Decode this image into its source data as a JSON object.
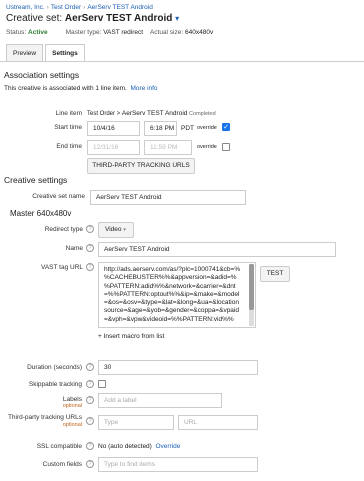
{
  "breadcrumb": {
    "items": [
      "Ustream, Inc.",
      "Test Order",
      "AerServ TEST Android"
    ],
    "separator": "›"
  },
  "header": {
    "title_prefix": "Creative set:",
    "title_name": "AerServ TEST Android",
    "status_label": "Status:",
    "status_value": "Active",
    "master_type_label": "Master type:",
    "master_type_value": "VAST redirect",
    "actual_size_label": "Actual size:",
    "actual_size_value": "640x480v"
  },
  "tabs": [
    "Preview",
    "Settings"
  ],
  "association": {
    "heading": "Association settings",
    "info_text": "This creative is associated with 1 line item.",
    "more_info": "More info",
    "line_item_label": "Line item",
    "line_item_order": "Test Order",
    "line_item_name": "AerServ TEST Android",
    "line_item_status": "Completed",
    "start_label": "Start time",
    "start_date": "10/4/16",
    "start_time": "6:18 PM",
    "start_tz": "PDT",
    "override_label": "override",
    "end_label": "End time",
    "end_date": "12/31/16",
    "end_time": "11:59 PM",
    "tracking_button": "THIRD-PARTY TRACKING URLS"
  },
  "creative": {
    "heading": "Creative settings",
    "set_name_label": "Creative set name",
    "set_name_value": "AerServ TEST Android",
    "master_heading": "Master 640x480v",
    "redirect_type_label": "Redirect type",
    "redirect_type_value": "Video",
    "name_label": "Name",
    "name_value": "AerServ TEST Android",
    "vast_label": "VAST tag URL",
    "vast_value": "http://ads.aerserv.com/as/?plc=1000741&cb=%%CACHEBUSTER%%&appversion=&adid=%%PATTERN:adid%%&network=&carrier=&dnt=%%PATTERN:optout%%&ip=&make=&model=&os=&osv=&type=&lat=&long=&ua=&locationsource=&age=&yob=&gender=&coppa=&vpaid=&vph=&vpw&videoid=%%PATTERN:vid%%",
    "test_button": "TEST",
    "insert_macro": "Insert macro from list",
    "duration_label": "Duration (seconds)",
    "duration_value": "30",
    "skippable_label": "Skippable tracking",
    "labels_label": "Labels",
    "optional": "optional",
    "labels_placeholder": "Add a label",
    "tracking_label": "Third-party tracking URLs",
    "type_placeholder": "Type",
    "url_placeholder": "URL",
    "ssl_label": "SSL compatible",
    "ssl_value": "No (auto detected)",
    "ssl_override": "Override",
    "custom_label": "Custom fields",
    "custom_placeholder": "Type to find items"
  },
  "colors": {
    "link": "#1a5fb4",
    "active": "#2e7d32",
    "optional": "#c0651c",
    "checkbox": "#1a73e8"
  },
  "icons": [
    "help-icon",
    "dropdown-caret-icon",
    "plus-icon",
    "checkbox-checked-icon"
  ]
}
